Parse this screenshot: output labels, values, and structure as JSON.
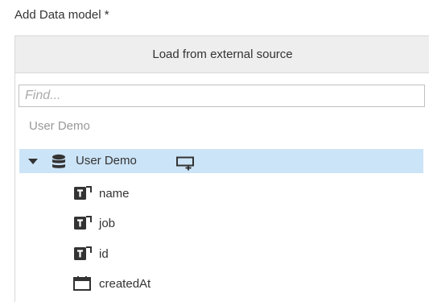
{
  "form": {
    "label": "Add Data model *"
  },
  "panel": {
    "load_button_label": "Load from external source",
    "search": {
      "placeholder": "Find...",
      "value": ""
    },
    "group_header": "User Demo",
    "tree": {
      "root": {
        "label": "User Demo",
        "expanded": true,
        "selected": true,
        "icon": "database-icon",
        "action_icon": "add-window-icon"
      },
      "fields": [
        {
          "label": "name",
          "icon": "text-field-icon"
        },
        {
          "label": "job",
          "icon": "text-field-icon"
        },
        {
          "label": "id",
          "icon": "text-field-icon"
        },
        {
          "label": "createdAt",
          "icon": "date-field-icon"
        }
      ]
    }
  },
  "colors": {
    "selected_row_bg": "#cce4f7",
    "button_bg": "#eeeeee",
    "border": "#d8d8d8",
    "muted_text": "#999999"
  }
}
